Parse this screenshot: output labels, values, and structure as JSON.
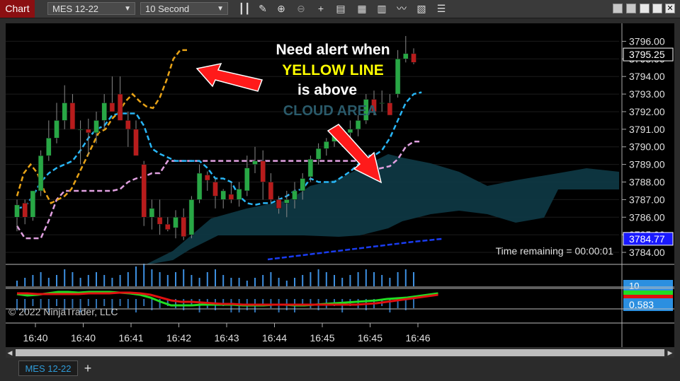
{
  "toolbar": {
    "chart_tab": "Chart",
    "instrument": "MES 12-22",
    "interval": "10 Second",
    "icons": [
      "bars-icon",
      "pencil-icon",
      "zoom-in-icon",
      "zoom-out-icon",
      "crosshair-icon",
      "properties-icon",
      "data-box-icon",
      "strategies-icon",
      "indicators-icon",
      "templates-icon",
      "more-icon"
    ]
  },
  "annotation": {
    "line1": "Need alert when",
    "line2": "YELLOW LINE",
    "line3": "is above",
    "line4": "CLOUD AREA"
  },
  "copyright": "© 2022 NinjaTrader, LLC",
  "time_remaining": "Time remaining = 00:00:01",
  "price_labels": {
    "last": "3795.25",
    "blue_line": "3784.77",
    "vol": "10",
    "osc": "0.583"
  },
  "bottom": {
    "instrument_tab": "MES 12-22",
    "add_tab": "+"
  },
  "colors": {
    "up": "#28a745",
    "down": "#b71c1c",
    "yellow": "#e8a317",
    "cyan": "#29b6f6",
    "pink": "#e0a0e0",
    "cloud": "#0e3a46",
    "blue_line": "#1a3cf0"
  },
  "chart_data": {
    "type": "candlestick",
    "x_ticks": [
      "16:40",
      "16:40",
      "16:41",
      "16:42",
      "16:43",
      "16:44",
      "16:45",
      "16:45",
      "16:46"
    ],
    "y_ticks": [
      "3796.00",
      "3795.00",
      "3794.00",
      "3793.00",
      "3792.00",
      "3791.00",
      "3790.00",
      "3789.00",
      "3788.00",
      "3787.00",
      "3786.00",
      "3785.00",
      "3784.00"
    ],
    "ylim": [
      3783.6,
      3796.7
    ],
    "candles": [
      {
        "o": 3786.0,
        "h": 3787.0,
        "l": 3785.2,
        "c": 3786.7
      },
      {
        "o": 3786.8,
        "h": 3787.0,
        "l": 3785.6,
        "c": 3786.0
      },
      {
        "o": 3786.0,
        "h": 3787.5,
        "l": 3785.8,
        "c": 3787.5
      },
      {
        "o": 3787.5,
        "h": 3789.8,
        "l": 3787.2,
        "c": 3789.5
      },
      {
        "o": 3789.5,
        "h": 3791.5,
        "l": 3789.2,
        "c": 3790.5
      },
      {
        "o": 3790.5,
        "h": 3792.5,
        "l": 3790.2,
        "c": 3791.5
      },
      {
        "o": 3791.5,
        "h": 3793.5,
        "l": 3791.0,
        "c": 3792.5
      },
      {
        "o": 3792.5,
        "h": 3793.0,
        "l": 3791.2,
        "c": 3791.0
      },
      {
        "o": 3791.0,
        "h": 3791.5,
        "l": 3789.0,
        "c": 3791.0
      },
      {
        "o": 3791.0,
        "h": 3791.6,
        "l": 3789.5,
        "c": 3790.8
      },
      {
        "o": 3790.8,
        "h": 3792.0,
        "l": 3790.2,
        "c": 3791.5
      },
      {
        "o": 3791.5,
        "h": 3793.0,
        "l": 3791.0,
        "c": 3792.5
      },
      {
        "o": 3792.5,
        "h": 3794.0,
        "l": 3792.0,
        "c": 3792.0
      },
      {
        "o": 3793.0,
        "h": 3794.0,
        "l": 3791.5,
        "c": 3791.5
      },
      {
        "o": 3791.5,
        "h": 3792.0,
        "l": 3790.0,
        "c": 3791.0
      },
      {
        "o": 3791.0,
        "h": 3791.5,
        "l": 3789.5,
        "c": 3789.5
      },
      {
        "o": 3789.0,
        "h": 3789.2,
        "l": 3785.5,
        "c": 3786.0
      },
      {
        "o": 3786.0,
        "h": 3787.0,
        "l": 3785.3,
        "c": 3786.5
      },
      {
        "o": 3786.0,
        "h": 3787.0,
        "l": 3785.0,
        "c": 3785.6
      },
      {
        "o": 3785.6,
        "h": 3786.0,
        "l": 3785.2,
        "c": 3785.3
      },
      {
        "o": 3785.4,
        "h": 3786.4,
        "l": 3784.8,
        "c": 3786.0
      },
      {
        "o": 3786.0,
        "h": 3786.5,
        "l": 3784.7,
        "c": 3784.9
      },
      {
        "o": 3785.0,
        "h": 3787.2,
        "l": 3784.8,
        "c": 3787.0
      },
      {
        "o": 3787.0,
        "h": 3789.0,
        "l": 3786.8,
        "c": 3788.5
      },
      {
        "o": 3788.4,
        "h": 3788.6,
        "l": 3787.5,
        "c": 3788.1
      },
      {
        "o": 3788.0,
        "h": 3788.2,
        "l": 3786.5,
        "c": 3787.2
      },
      {
        "o": 3787.0,
        "h": 3787.6,
        "l": 3786.5,
        "c": 3787.5
      },
      {
        "o": 3787.3,
        "h": 3788.0,
        "l": 3786.8,
        "c": 3787.0
      },
      {
        "o": 3787.0,
        "h": 3788.0,
        "l": 3786.6,
        "c": 3787.6
      },
      {
        "o": 3787.5,
        "h": 3789.5,
        "l": 3787.2,
        "c": 3788.8
      },
      {
        "o": 3789.0,
        "h": 3790.0,
        "l": 3788.5,
        "c": 3789.2
      },
      {
        "o": 3789.2,
        "h": 3789.8,
        "l": 3787.0,
        "c": 3788.0
      },
      {
        "o": 3788.0,
        "h": 3788.5,
        "l": 3786.8,
        "c": 3787.0
      },
      {
        "o": 3787.0,
        "h": 3787.2,
        "l": 3786.2,
        "c": 3786.5
      },
      {
        "o": 3786.8,
        "h": 3787.5,
        "l": 3786.0,
        "c": 3787.0
      },
      {
        "o": 3787.0,
        "h": 3788.0,
        "l": 3786.5,
        "c": 3787.5
      },
      {
        "o": 3787.5,
        "h": 3788.5,
        "l": 3787.0,
        "c": 3788.2
      },
      {
        "o": 3788.3,
        "h": 3789.5,
        "l": 3788.0,
        "c": 3789.3
      },
      {
        "o": 3789.3,
        "h": 3790.2,
        "l": 3789.0,
        "c": 3789.9
      },
      {
        "o": 3789.9,
        "h": 3790.5,
        "l": 3789.5,
        "c": 3790.3
      },
      {
        "o": 3790.3,
        "h": 3791.0,
        "l": 3790.0,
        "c": 3790.8
      },
      {
        "o": 3790.5,
        "h": 3791.0,
        "l": 3790.0,
        "c": 3790.8
      },
      {
        "o": 3790.8,
        "h": 3791.5,
        "l": 3790.5,
        "c": 3791.0
      },
      {
        "o": 3791.0,
        "h": 3791.8,
        "l": 3790.6,
        "c": 3791.5
      },
      {
        "o": 3791.5,
        "h": 3793.0,
        "l": 3791.3,
        "c": 3792.7
      },
      {
        "o": 3792.7,
        "h": 3793.2,
        "l": 3791.8,
        "c": 3792.0
      },
      {
        "o": 3792.5,
        "h": 3793.2,
        "l": 3792.0,
        "c": 3792.5
      },
      {
        "o": 3792.5,
        "h": 3793.0,
        "l": 3791.8,
        "c": 3791.8
      },
      {
        "o": 3793.0,
        "h": 3795.5,
        "l": 3792.8,
        "c": 3795.0
      },
      {
        "o": 3795.0,
        "h": 3796.3,
        "l": 3794.8,
        "c": 3795.3
      },
      {
        "o": 3795.3,
        "h": 3795.6,
        "l": 3794.7,
        "c": 3794.8
      }
    ],
    "yellow_line": [
      3787.2,
      3788.5,
      3789.0,
      3788.5,
      3787.5,
      3786.8,
      3787.0,
      3787.2,
      3787.6,
      3788.4,
      3789.2,
      3790.0,
      3790.8,
      3791.0,
      3791.6,
      3792.0,
      3792.6,
      3793.0,
      3792.6,
      3792.3,
      3792.2,
      3792.8,
      3793.8,
      3795.0,
      3795.5,
      3795.5
    ],
    "cyan_line": [
      3786.5,
      3786.6,
      3787.2,
      3788.0,
      3788.5,
      3788.8,
      3789.0,
      3789.2,
      3789.8,
      3790.5,
      3791.0,
      3791.2,
      3791.8,
      3791.9,
      3791.9,
      3791.9,
      3791.2,
      3789.9,
      3789.6,
      3789.4,
      3789.2,
      3789.2,
      3789.2,
      3789.2,
      3788.8,
      3788.2,
      3788.2,
      3788.0,
      3787.2,
      3786.8,
      3786.7,
      3786.8,
      3786.8,
      3787.0,
      3787.2,
      3787.5,
      3787.6,
      3788.2,
      3788.0,
      3788.0,
      3788.0,
      3788.3,
      3788.6,
      3789.0,
      3789.5,
      3789.5,
      3789.8,
      3790.5,
      3791.5,
      3792.5,
      3793.0,
      3793.1
    ],
    "pink_line": [
      3785.5,
      3784.8,
      3784.8,
      3784.8,
      3785.8,
      3787.0,
      3787.5,
      3787.5,
      3787.5,
      3787.5,
      3787.5,
      3787.5,
      3787.5,
      3787.6,
      3788.0,
      3788.2,
      3788.3,
      3788.5,
      3788.5,
      3789.2,
      3789.2,
      3789.2,
      3789.2,
      3789.2,
      3789.2,
      3789.2,
      3789.2,
      3789.2,
      3789.2,
      3789.2,
      3789.2,
      3789.2,
      3789.2,
      3789.2,
      3789.2,
      3789.2,
      3789.2,
      3789.2,
      3789.2,
      3789.2,
      3789.2,
      3789.2,
      3789.2,
      3789.2,
      3788.8,
      3788.7,
      3788.8,
      3788.9,
      3789.3,
      3790.0,
      3790.3,
      3790.3
    ],
    "blue_line": [
      3783.6,
      3783.8,
      3784.0,
      3784.2,
      3784.4,
      3784.6,
      3784.77
    ],
    "volume": [
      2,
      3,
      4,
      5,
      3,
      4,
      6,
      5,
      3,
      4,
      5,
      4,
      3,
      4,
      5,
      7,
      8,
      6,
      5,
      4,
      5,
      6,
      4,
      3,
      5,
      6,
      4,
      3,
      3,
      2,
      3,
      4,
      5,
      3,
      2,
      3,
      4,
      5,
      6,
      5,
      4,
      3,
      4,
      5,
      6,
      5,
      4,
      3,
      5,
      6,
      5
    ],
    "osc_red": [
      0.9,
      0.9,
      0.85,
      0.85,
      0.85,
      0.85,
      0.85,
      0.9,
      0.9,
      0.9,
      0.95,
      0.95,
      0.9,
      0.8,
      0.6,
      0.4,
      0.3,
      0.3,
      0.25,
      0.2,
      0.15,
      0.15,
      0.1,
      0.1,
      0.1,
      0.1,
      0.1,
      0.1,
      0.1,
      0.1,
      0.1,
      0.1,
      0.1,
      0.1,
      0.15,
      0.2,
      0.3,
      0.4,
      0.5,
      0.6,
      0.7,
      0.8
    ],
    "osc_green": [
      0.85,
      0.75,
      0.8,
      0.9,
      1.0,
      1.0,
      0.95,
      1.0,
      1.0,
      1.0,
      0.95,
      0.9,
      0.8,
      0.6,
      0.3,
      0.05,
      0.05,
      0.05,
      0.1,
      0.1,
      0.1,
      0.1,
      0.05,
      0.05,
      0.05,
      0.1,
      0.1,
      0.05,
      0.05,
      0.1,
      0.15,
      0.2,
      0.25,
      0.3,
      0.35,
      0.4,
      0.5,
      0.55,
      0.6,
      0.7,
      0.8,
      0.9
    ]
  }
}
